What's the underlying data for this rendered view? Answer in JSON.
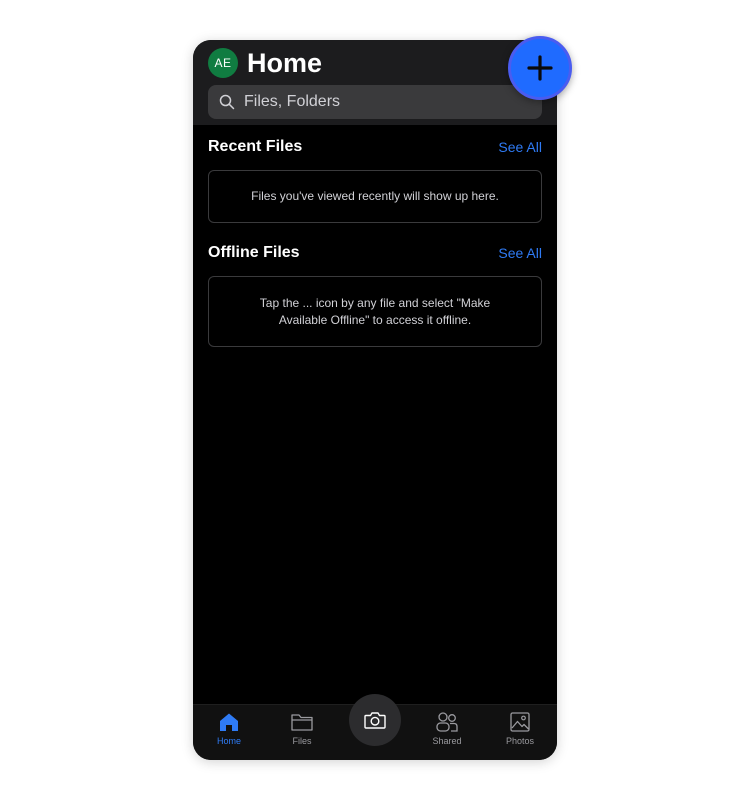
{
  "header": {
    "avatar_initials": "AE",
    "title": "Home",
    "search": {
      "placeholder": "Files, Folders",
      "value": ""
    }
  },
  "sections": {
    "recent": {
      "title": "Recent Files",
      "see_all": "See All",
      "empty_message": "Files you've viewed recently will show up here."
    },
    "offline": {
      "title": "Offline Files",
      "see_all": "See All",
      "empty_message": "Tap the ... icon by any file and select \"Make Available Offline\" to access it offline."
    }
  },
  "tabbar": {
    "items": [
      {
        "label": "Home",
        "icon": "home-icon",
        "active": true
      },
      {
        "label": "Files",
        "icon": "folder-icon",
        "active": false
      },
      {
        "label": "Shared",
        "icon": "people-icon",
        "active": false
      },
      {
        "label": "Photos",
        "icon": "image-icon",
        "active": false
      }
    ],
    "camera_icon": "camera-icon"
  },
  "fab": {
    "icon": "plus-icon"
  },
  "colors": {
    "background": "#000000",
    "header": "#1c1c1e",
    "accent": "#2f7bf5",
    "avatar": "#107c41",
    "fab": "#1f6bff"
  }
}
